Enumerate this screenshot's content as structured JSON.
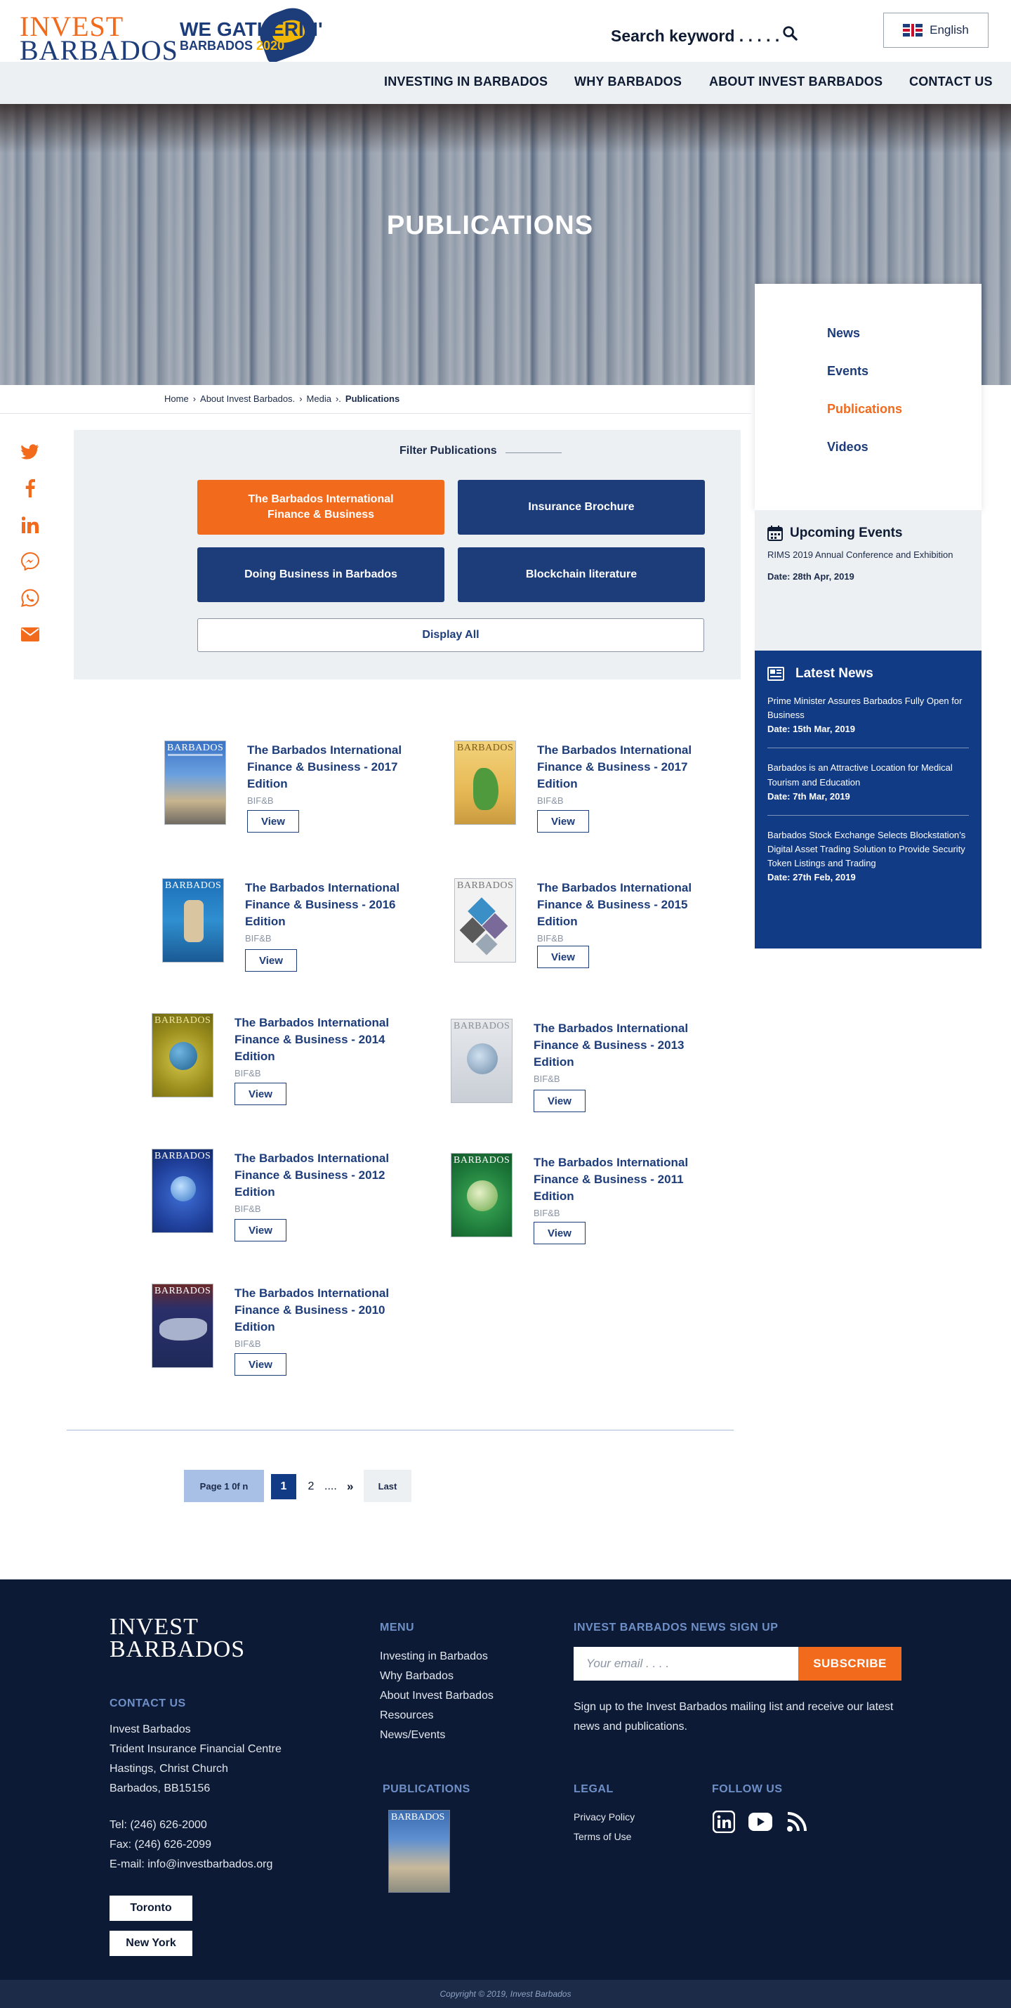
{
  "header": {
    "logo_line1": "INVEST",
    "logo_line2": "BARBADOS",
    "campaign_line1": "WE GATHERIN'",
    "campaign_line2": "BARBADOS",
    "campaign_year": "2020",
    "search_label": "Search keyword . . . . .",
    "language": "English"
  },
  "nav": {
    "items": [
      "INVESTING IN BARBADOS",
      "WHY BARBADOS",
      "ABOUT INVEST BARBADOS",
      "CONTACT US"
    ]
  },
  "hero": {
    "title": "PUBLICATIONS"
  },
  "breadcrumb": {
    "items": [
      "Home",
      "About Invest Barbados.",
      "Media"
    ],
    "separators": [
      "›",
      "›",
      "›."
    ],
    "current": "Publications"
  },
  "social": {
    "icons": [
      "twitter-icon",
      "facebook-icon",
      "linkedin-icon",
      "messenger-icon",
      "whatsapp-icon",
      "email-icon"
    ],
    "color": "#f26a1b"
  },
  "filter": {
    "title": "Filter Publications",
    "buttons": [
      "The Barbados International Finance & Business",
      "Insurance Brochure",
      "Doing Business in Barbados",
      "Blockchain literature"
    ],
    "display_all": "Display All"
  },
  "sidebar": {
    "menu": [
      "News",
      "Events",
      "Publications",
      "Videos"
    ],
    "active": "Publications",
    "upcoming": {
      "title": "Upcoming Events",
      "event": "RIMS 2019 Annual Conference and Exhibition",
      "date": "Date: 28th Apr, 2019"
    },
    "latest": {
      "title": "Latest News",
      "items": [
        {
          "text": "Prime Minister Assures Barbados Fully Open for Business",
          "date": "Date: 15th Mar, 2019"
        },
        {
          "text": "Barbados is an Attractive Location for Medical Tourism and Education",
          "date": "Date: 7th Mar, 2019"
        },
        {
          "text": "Barbados Stock Exchange Selects Blockstation’s Digital Asset Trading Solution to Provide Security Token Listings and Trading",
          "date": "Date: 27th Feb, 2019"
        }
      ]
    }
  },
  "publications": {
    "cover_masthead": "BARBADOS",
    "items": [
      {
        "title": "The Barbados International Finance & Business - 2017 Edition",
        "tag": "BIF&B",
        "button": "View"
      },
      {
        "title": "The Barbados International Finance & Business - 2017 Edition",
        "tag": "BIF&B",
        "button": "View"
      },
      {
        "title": "The Barbados International Finance & Business - 2016 Edition",
        "tag": "BIF&B",
        "button": "View"
      },
      {
        "title": "The Barbados International Finance & Business - 2015 Edition",
        "tag": "BIF&B",
        "button": "View"
      },
      {
        "title": "The Barbados International Finance & Business - 2014 Edition",
        "tag": "BIF&B",
        "button": "View"
      },
      {
        "title": "The Barbados International Finance & Business - 2013 Edition",
        "tag": "BIF&B",
        "button": "View"
      },
      {
        "title": "The Barbados International Finance & Business - 2012 Edition",
        "tag": "BIF&B",
        "button": "View"
      },
      {
        "title": "The Barbados International Finance & Business - 2011 Edition",
        "tag": "BIF&B",
        "button": "View"
      },
      {
        "title": "The Barbados International Finance & Business - 2010 Edition",
        "tag": "BIF&B",
        "button": "View"
      }
    ]
  },
  "pagination": {
    "label": "Page 1 0f n",
    "current": "1",
    "next_page": "2",
    "ellipsis": "....",
    "next": "»",
    "last": "Last"
  },
  "footer": {
    "logo_line1": "INVEST",
    "logo_line2": "BARBADOS",
    "contact": {
      "heading": "CONTACT US",
      "lines": [
        "Invest Barbados",
        "Trident Insurance Financial Centre",
        "Hastings, Christ Church",
        "Barbados, BB15156"
      ],
      "tel": "Tel: (246) 626-2000",
      "fax": "Fax: (246) 626-2099",
      "email": "E-mail: info@investbarbados.org"
    },
    "offices": [
      "Toronto",
      "New York"
    ],
    "menu": {
      "heading": "MENU",
      "items": [
        "Investing in Barbados",
        "Why Barbados",
        "About Invest Barbados",
        "Resources",
        "News/Events"
      ]
    },
    "signup": {
      "heading": "INVEST BARBADOS NEWS SIGN UP",
      "placeholder": "Your email . . . .",
      "button": "SUBSCRIBE",
      "text": "Sign up to the Invest Barbados mailing list and receive our latest  news and publications."
    },
    "publications_heading": "PUBLICATIONS",
    "legal": {
      "heading": "LEGAL",
      "items": [
        "Privacy Policy",
        "Terms of Use"
      ]
    },
    "follow": {
      "heading": "FOLLOW US",
      "icons": [
        "linkedin-icon",
        "youtube-icon",
        "rss-icon"
      ]
    },
    "copyright": "Copyright © 2019, Invest Barbados"
  },
  "colors": {
    "brand_blue": "#1d3c7a",
    "brand_orange": "#f26a1b",
    "footer_bg": "#0c1a35",
    "news_bg": "#123b85"
  }
}
